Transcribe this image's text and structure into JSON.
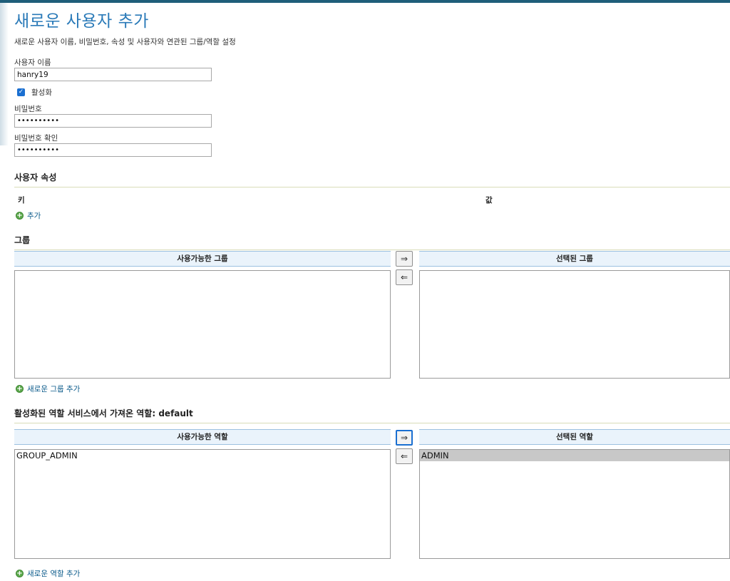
{
  "page": {
    "title": "새로운 사용자 추가",
    "description": "새로운 사용자 이름, 비밀번호, 속성 및 사용자와 연관된 그룹/역할 설정"
  },
  "form": {
    "username_label": "사용자 이름",
    "username_value": "hanry19",
    "enabled_label": "활성화",
    "enabled_checked": true,
    "password_label": "비밀번호",
    "password_value": "••••••••••",
    "password_confirm_label": "비밀번호 확인",
    "password_confirm_value": "••••••••••"
  },
  "attributes": {
    "section_title": "사용자 속성",
    "key_header": "키",
    "value_header": "값",
    "add_label": "추가"
  },
  "groups": {
    "section_title": "그룹",
    "available_header": "사용가능한 그룹",
    "selected_header": "선택된 그룹",
    "available_items": [],
    "selected_items": [],
    "move_right": "⇒",
    "move_left": "⇐",
    "add_label": "새로운 그룹 추가"
  },
  "roles": {
    "section_title_prefix": "활성화된 역할 서비스에서 가져온 역할: ",
    "section_title_value": "default",
    "available_header": "사용가능한 역할",
    "selected_header": "선택된 역할",
    "available_items": [
      "GROUP_ADMIN"
    ],
    "selected_items": [
      "ADMIN"
    ],
    "move_right": "⇒",
    "move_left": "⇐",
    "add_label": "새로운 역할 추가"
  },
  "colors": {
    "title": "#2a7ab8",
    "link": "#0a5a8a",
    "header_bg": "#eaf3fb",
    "selected_item_bg": "#c8c8c8"
  }
}
